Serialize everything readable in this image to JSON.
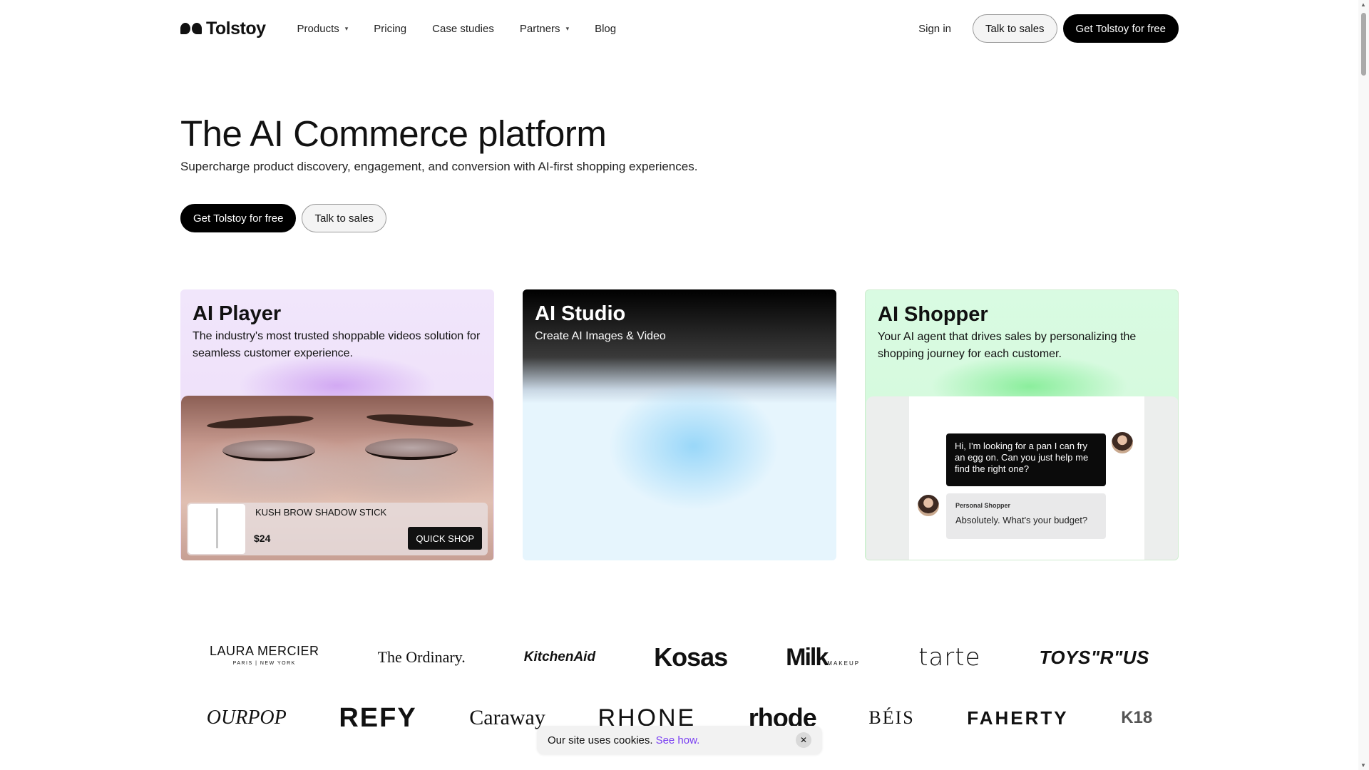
{
  "nav": {
    "logo_text": "Tolstoy",
    "menu": [
      {
        "label": "Products",
        "has_dropdown": true
      },
      {
        "label": "Pricing",
        "has_dropdown": false
      },
      {
        "label": "Case studies",
        "has_dropdown": false
      },
      {
        "label": "Partners",
        "has_dropdown": true
      },
      {
        "label": "Blog",
        "has_dropdown": false
      }
    ],
    "sign_in": "Sign in",
    "talk_to_sales": "Talk to sales",
    "get_started": "Get Tolstoy for free"
  },
  "hero": {
    "title": "The AI Commerce platform",
    "subtitle": "Supercharge product discovery, engagement, and conversion with AI-first shopping experiences.",
    "primary_cta": "Get Tolstoy for free",
    "secondary_cta": "Talk to sales"
  },
  "cards": {
    "player": {
      "title": "AI Player",
      "description": "The industry's most trusted shoppable videos solution for seamless customer experience.",
      "product_name": "KUSH BROW SHADOW STICK",
      "product_price": "$24",
      "quick_shop": "QUICK SHOP"
    },
    "studio": {
      "title": "AI Studio",
      "description": "Create AI Images & Video"
    },
    "shopper": {
      "title": "AI Shopper",
      "description": "Your AI agent that drives sales by personalizing the shopping journey for each customer.",
      "user_message": "Hi, I'm looking for a pan I can fry an egg on. Can you just help me find the right one?",
      "agent_label": "Personal Shopper",
      "agent_message": "Absolutely. What's your budget?"
    }
  },
  "logos": {
    "row1": [
      "LAURA MERCIER",
      "PARIS | NEW YORK",
      "The Ordinary.",
      "KitchenAid",
      "Kosas",
      "Milk",
      "MAKEUP",
      "tarte",
      "TOYS\"R\"US"
    ],
    "row2": [
      "OURPOP",
      "REFY",
      "Caraway",
      "RHONE",
      "rhode",
      "BÉIS",
      "FAHERTY",
      "K18"
    ]
  },
  "cookie": {
    "text": "Our site uses cookies.",
    "link": "See how.",
    "close": "✕"
  },
  "colors": {
    "accent_link": "#7a3ff2",
    "primary_button": "#000000",
    "player_bg": "#f1e6fb",
    "shopper_bg": "#d9fbe2",
    "studio_bg": "#e6f5fd"
  }
}
